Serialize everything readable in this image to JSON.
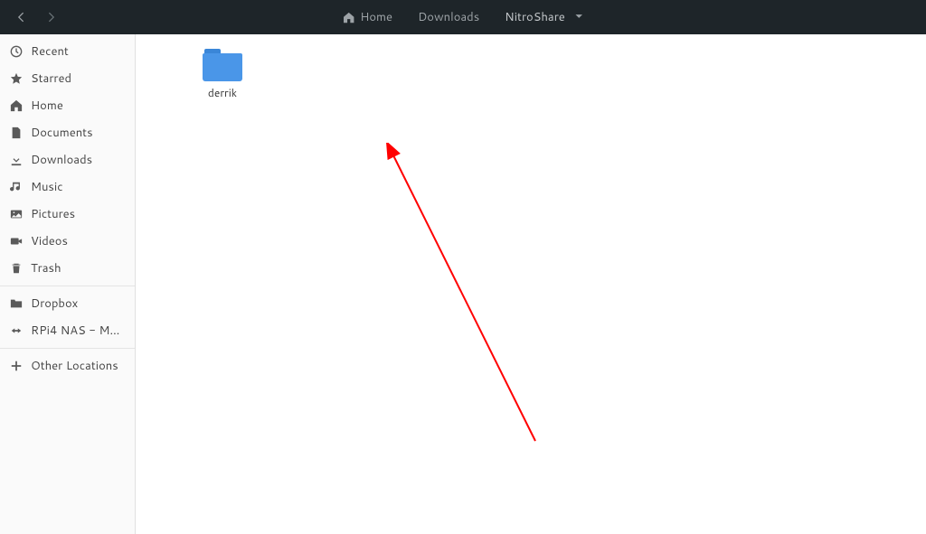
{
  "header": {
    "breadcrumbs": [
      {
        "label": "Home",
        "has_icon": true
      },
      {
        "label": "Downloads"
      },
      {
        "label": "NitroShare",
        "current": true,
        "has_dropdown": true
      }
    ]
  },
  "sidebar": {
    "section1": [
      {
        "icon": "clock",
        "label": "Recent"
      },
      {
        "icon": "star",
        "label": "Starred"
      },
      {
        "icon": "home",
        "label": "Home"
      },
      {
        "icon": "document",
        "label": "Documents"
      },
      {
        "icon": "download",
        "label": "Downloads"
      },
      {
        "icon": "music",
        "label": "Music"
      },
      {
        "icon": "pictures",
        "label": "Pictures"
      },
      {
        "icon": "video",
        "label": "Videos"
      },
      {
        "icon": "trash",
        "label": "Trash"
      }
    ],
    "section2": [
      {
        "icon": "folder",
        "label": "Dropbox"
      },
      {
        "icon": "network",
        "label": "RPi4 NAS - Me..."
      }
    ],
    "section3": [
      {
        "icon": "plus",
        "label": "Other Locations"
      }
    ]
  },
  "content": {
    "folders": [
      {
        "name": "derrik"
      }
    ]
  }
}
